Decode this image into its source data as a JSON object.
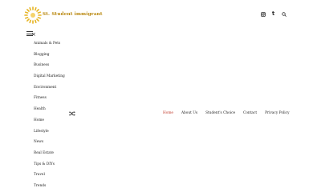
{
  "header": {
    "brand": "St. Student immigrant",
    "icons": [
      "instagram-icon",
      "tumblr-icon",
      "search-icon"
    ],
    "tumblr_glyph": "t"
  },
  "menu": {
    "toggle_icon": "hamburger-icon",
    "close_glyph": "×",
    "categories": [
      "Animals & Pets",
      "Blogging",
      "Business",
      "Digital Marketing",
      "Environment",
      "Fitness",
      "Health",
      "Home",
      "Lifestyle",
      "News",
      "Real Estate",
      "Tips & DIYs",
      "Travel",
      "Trends"
    ]
  },
  "nav": {
    "shuffle_icon": "shuffle-icon",
    "items": [
      "Home",
      "About Us",
      "Student's Choice",
      "Contact",
      "Privacy Policy"
    ],
    "active_index": 0
  },
  "colors": {
    "accent": "#c0392b",
    "brand": "#b8860b",
    "logo_rays": "#e6b422"
  }
}
